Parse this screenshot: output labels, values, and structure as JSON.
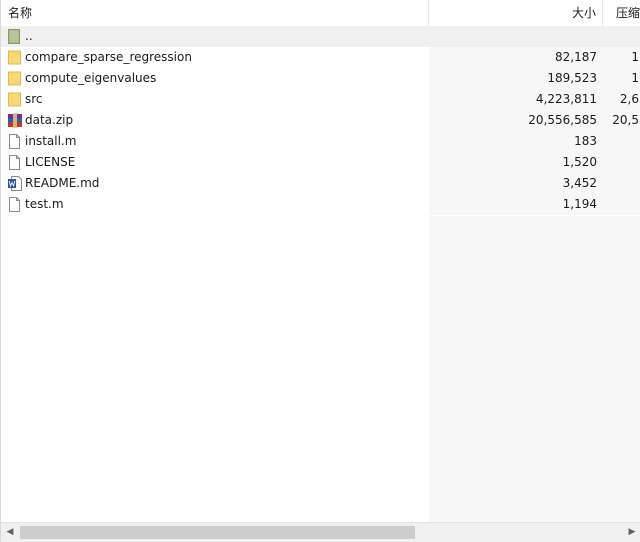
{
  "header": {
    "col_name": "名称",
    "col_size": "大小",
    "col_packed": "压缩",
    "sort_indicator": "^"
  },
  "files": [
    {
      "name": "..",
      "size": "",
      "packed": "",
      "icon": "parent-folder-icon"
    },
    {
      "name": "compare_sparse_regression",
      "size": "82,187",
      "packed": "1",
      "icon": "folder-icon"
    },
    {
      "name": "compute_eigenvalues",
      "size": "189,523",
      "packed": "1",
      "icon": "folder-icon"
    },
    {
      "name": "src",
      "size": "4,223,811",
      "packed": "2,6",
      "icon": "folder-icon"
    },
    {
      "name": "data.zip",
      "size": "20,556,585",
      "packed": "20,5",
      "icon": "archive-icon"
    },
    {
      "name": "install.m",
      "size": "183",
      "packed": "",
      "icon": "file-icon"
    },
    {
      "name": "LICENSE",
      "size": "1,520",
      "packed": "",
      "icon": "file-icon"
    },
    {
      "name": "README.md",
      "size": "3,452",
      "packed": "",
      "icon": "word-doc-icon"
    },
    {
      "name": "test.m",
      "size": "1,194",
      "packed": "",
      "icon": "file-icon"
    }
  ],
  "colors": {
    "folder": "#f8d775",
    "selection": "#f0f0f0",
    "column_shade": "#f7f7f7"
  }
}
